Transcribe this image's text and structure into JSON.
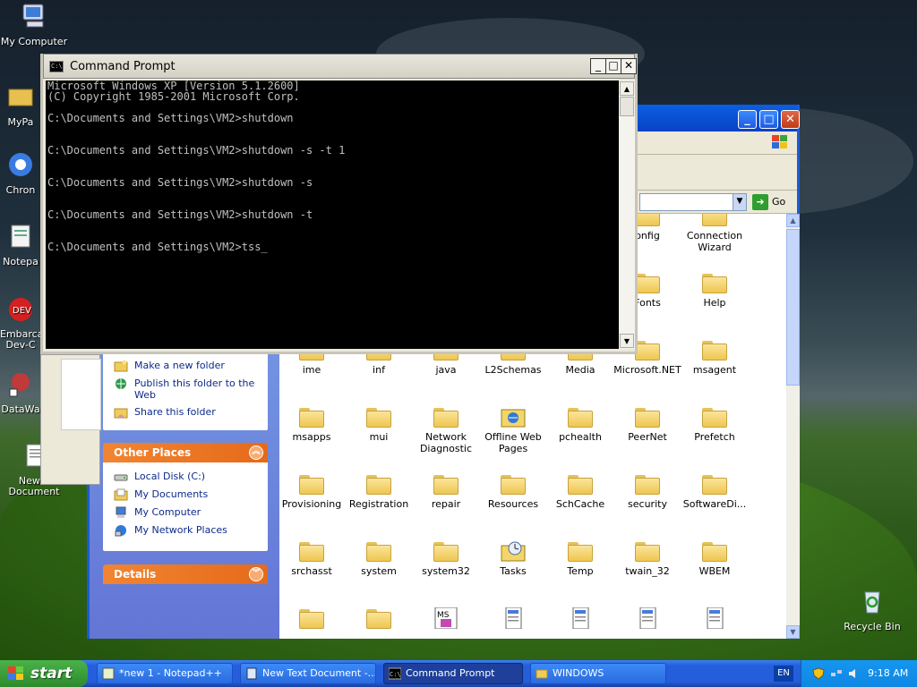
{
  "desktop_icons": [
    {
      "label": "My Computer"
    },
    {
      "label": "MyPa"
    },
    {
      "label": "Chron"
    },
    {
      "label": "Notepa"
    },
    {
      "label": "Embarca Dev-C"
    },
    {
      "label": "DataWa"
    },
    {
      "label": "New T Document"
    },
    {
      "label": "Recycle Bin"
    }
  ],
  "cmd": {
    "title": "Command Prompt",
    "lines": [
      "Microsoft Windows XP [Version 5.1.2600]",
      "(C) Copyright 1985-2001 Microsoft Corp.",
      "",
      "C:\\Documents and Settings\\VM2>shutdown",
      "",
      "",
      "C:\\Documents and Settings\\VM2>shutdown -s -t 1",
      "",
      "",
      "C:\\Documents and Settings\\VM2>shutdown -s",
      "",
      "",
      "C:\\Documents and Settings\\VM2>shutdown -t",
      "",
      "",
      "C:\\Documents and Settings\\VM2>tss_"
    ]
  },
  "explorer": {
    "address_go": "Go",
    "file_tasks": [
      {
        "label": "Make a new folder"
      },
      {
        "label": "Publish this folder to the Web"
      },
      {
        "label": "Share this folder"
      }
    ],
    "other_places_title": "Other Places",
    "other_places": [
      {
        "label": "Local Disk (C:)"
      },
      {
        "label": "My Documents"
      },
      {
        "label": "My Computer"
      },
      {
        "label": "My Network Places"
      }
    ],
    "details_title": "Details",
    "files": [
      {
        "label": "onfig",
        "kind": "folder"
      },
      {
        "label": "Connection Wizard",
        "kind": "folder"
      },
      {
        "label": "Fonts",
        "kind": "folder"
      },
      {
        "label": "Help",
        "kind": "folder"
      },
      {
        "label": "ime",
        "kind": "folder"
      },
      {
        "label": "inf",
        "kind": "folder"
      },
      {
        "label": "java",
        "kind": "folder"
      },
      {
        "label": "L2Schemas",
        "kind": "folder"
      },
      {
        "label": "Media",
        "kind": "folder"
      },
      {
        "label": "Microsoft.NET",
        "kind": "folder"
      },
      {
        "label": "msagent",
        "kind": "folder"
      },
      {
        "label": "msapps",
        "kind": "folder"
      },
      {
        "label": "mui",
        "kind": "folder"
      },
      {
        "label": "Network Diagnostic",
        "kind": "folder"
      },
      {
        "label": "Offline Web Pages",
        "kind": "special-folder"
      },
      {
        "label": "pchealth",
        "kind": "folder"
      },
      {
        "label": "PeerNet",
        "kind": "folder"
      },
      {
        "label": "Prefetch",
        "kind": "folder"
      },
      {
        "label": "Provisioning",
        "kind": "folder"
      },
      {
        "label": "Registration",
        "kind": "folder"
      },
      {
        "label": "repair",
        "kind": "folder"
      },
      {
        "label": "Resources",
        "kind": "folder"
      },
      {
        "label": "SchCache",
        "kind": "folder"
      },
      {
        "label": "security",
        "kind": "folder"
      },
      {
        "label": "SoftwareDi...",
        "kind": "folder"
      },
      {
        "label": "srchasst",
        "kind": "folder"
      },
      {
        "label": "system",
        "kind": "folder"
      },
      {
        "label": "system32",
        "kind": "folder"
      },
      {
        "label": "Tasks",
        "kind": "tasks-folder"
      },
      {
        "label": "Temp",
        "kind": "folder"
      },
      {
        "label": "twain_32",
        "kind": "folder"
      },
      {
        "label": "WBEM",
        "kind": "folder"
      }
    ]
  },
  "taskbar": {
    "start_label": "start",
    "tasks": [
      {
        "label": "*new 1 - Notepad++"
      },
      {
        "label": "New Text Document -..."
      },
      {
        "label": "Command Prompt"
      },
      {
        "label": "WINDOWS"
      }
    ],
    "lang": "EN",
    "clock": "9:18 AM"
  },
  "colors": {
    "taskbar": "#245edb",
    "start": "#2d8a2d",
    "console_bg": "#000000",
    "console_fg": "#c0c0c0",
    "panel_header": "#e56a1a"
  }
}
